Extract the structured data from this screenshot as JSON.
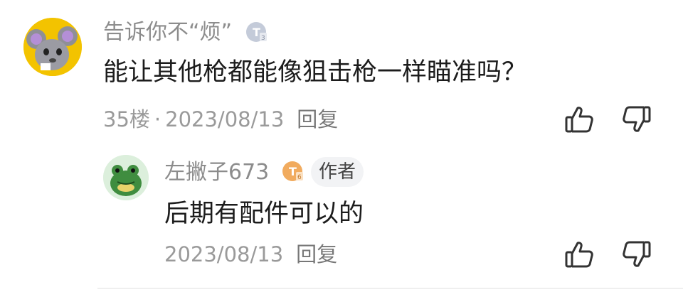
{
  "comment": {
    "username": "告诉你不“烦”",
    "badge_icon": "level-badge-icon",
    "text": "能让其他枪都能像狙击枪一样瞄准吗？",
    "floor": "35楼",
    "separator": "·",
    "date": "2023/08/13",
    "reply_label": "回复",
    "avatar": "mouse-avatar"
  },
  "reply": {
    "username": "左撇子673",
    "badge_icon": "level-badge-icon",
    "author_tag": "作者",
    "text": "后期有配件可以的",
    "date": "2023/08/13",
    "reply_label": "回复",
    "avatar": "frog-avatar"
  },
  "colors": {
    "username": "#8c8c8c",
    "text": "#1c1c1c",
    "meta": "#9a9a9a",
    "icon": "#333333",
    "badge_main": "#b8c2d6",
    "badge_reply": "#f0a75a"
  },
  "icons": {
    "like": "thumbs-up-icon",
    "dislike": "thumbs-down-icon"
  }
}
